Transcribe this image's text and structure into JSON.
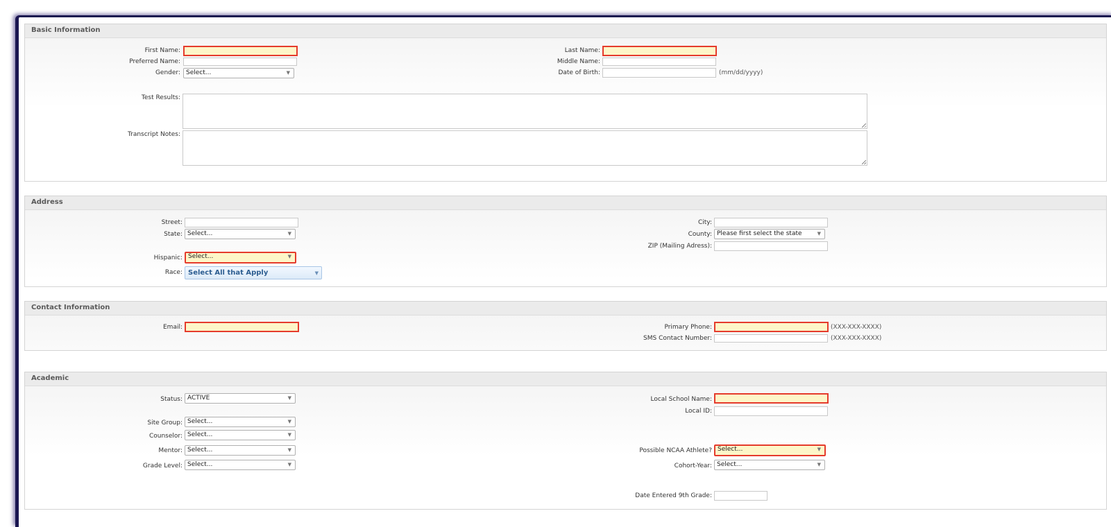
{
  "basic": {
    "title": "Basic Information",
    "first_name_label": "First Name:",
    "preferred_name_label": "Preferred Name:",
    "gender_label": "Gender:",
    "gender_value": "Select...",
    "last_name_label": "Last Name:",
    "middle_name_label": "Middle Name:",
    "dob_label": "Date of Birth:",
    "dob_hint": "(mm/dd/yyyy)",
    "test_results_label": "Test Results:",
    "transcript_notes_label": "Transcript Notes:"
  },
  "address": {
    "title": "Address",
    "street_label": "Street:",
    "state_label": "State:",
    "state_value": "Select...",
    "hispanic_label": "Hispanic:",
    "hispanic_value": "Select...",
    "race_label": "Race:",
    "race_value": "Select All that Apply",
    "city_label": "City:",
    "county_label": "County:",
    "county_value": "Please first select the state",
    "zip_label": "ZIP (Mailing Adress):"
  },
  "contact": {
    "title": "Contact Information",
    "email_label": "Email:",
    "primary_phone_label": "Primary Phone:",
    "primary_phone_hint": "(XXX-XXX-XXXX)",
    "sms_label": "SMS Contact Number:",
    "sms_hint": "(XXX-XXX-XXXX)"
  },
  "academic": {
    "title": "Academic",
    "status_label": "Status:",
    "status_value": "ACTIVE",
    "site_group_label": "Site Group:",
    "site_group_value": "Select...",
    "counselor_label": "Counselor:",
    "counselor_value": "Select...",
    "mentor_label": "Mentor:",
    "mentor_value": "Select...",
    "grade_level_label": "Grade Level:",
    "grade_level_value": "Select...",
    "local_school_label": "Local School Name:",
    "local_id_label": "Local ID:",
    "ncaa_label": "Possible NCAA Athlete?",
    "ncaa_value": "Select...",
    "cohort_label": "Cohort-Year:",
    "cohort_value": "Select...",
    "date_9th_label": "Date Entered 9th Grade:"
  },
  "icons": {
    "dropdown_arrow": "▼"
  },
  "colors": {
    "required_border": "#e53b2c",
    "required_fill": "#fdf6c8",
    "frame": "#1a1650"
  }
}
